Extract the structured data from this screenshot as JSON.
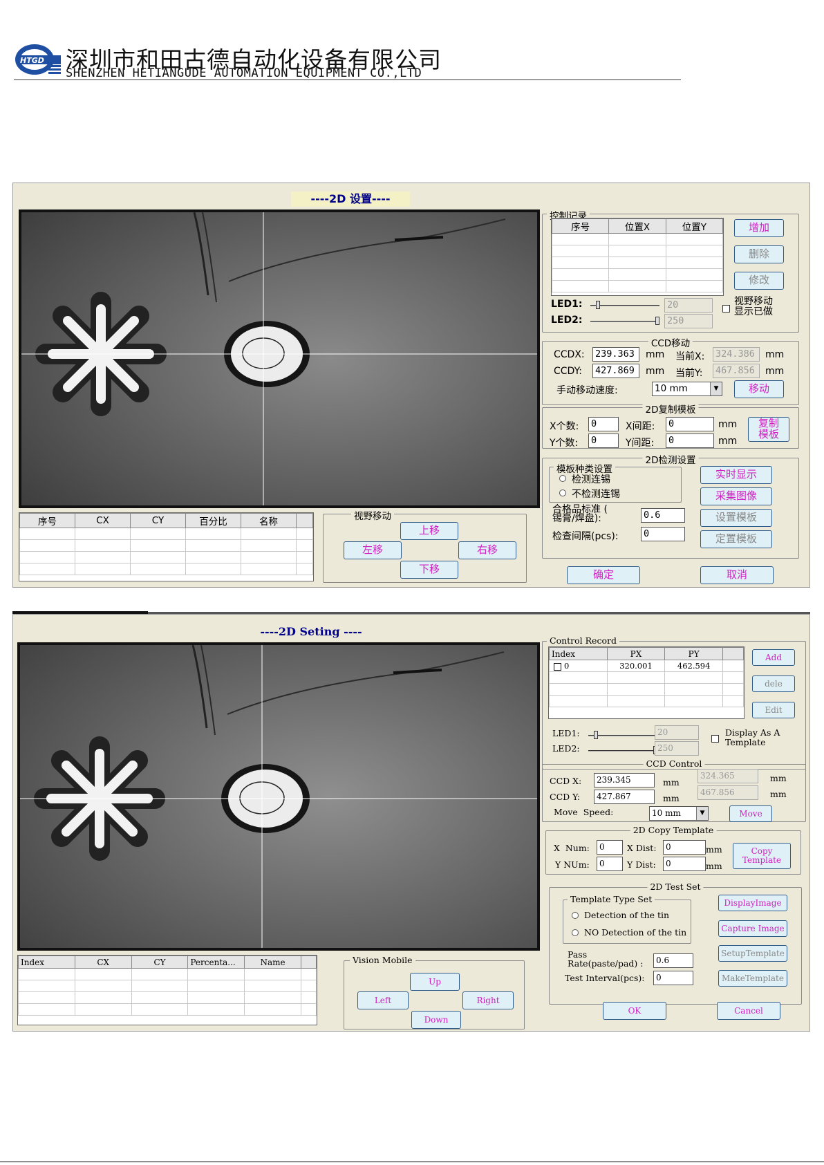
{
  "header": {
    "logo_text": "HTGD",
    "company_cn": "深圳市和田古德自动化设备有限公司",
    "company_en": "SHENZHEN HETIANGUDE AUTOMATION EQUIPMENT CO.,LTD"
  },
  "cn": {
    "title": "----2D 设置----",
    "record_group": "控制记录",
    "record_cols": [
      "序号",
      "位置X",
      "位置Y"
    ],
    "add": "增加",
    "delete": "删除",
    "edit": "修改",
    "led1": "LED1:",
    "led1_value": "20",
    "led1_level": 0.08,
    "led2": "LED2:",
    "led2_value": "250",
    "led2_level": 1.0,
    "display_check": "视野移动\n显示已做",
    "ccd_group": "CCD移动",
    "ccdx_label": "CCDX:",
    "ccdx_value": "239.363",
    "ccdy_label": "CCDY:",
    "ccdy_value": "427.869",
    "mm": "mm",
    "curx_label": "当前X:",
    "curx_value": "324.386",
    "cury_label": "当前Y:",
    "cury_value": "467.856",
    "speed_label": "手动移动速度:",
    "speed_value": "10 mm",
    "move": "移动",
    "copy_group": "2D复制模板",
    "xnum_label": "X个数:",
    "xnum_value": "0",
    "ynum_label": "Y个数:",
    "ynum_value": "0",
    "xdist_label": "X间距:",
    "xdist_value": "0",
    "ydist_label": "Y间距:",
    "ydist_value": "0",
    "copy_btn": "复制\n模板",
    "test_group": "2D检测设置",
    "type_group": "模板种类设置",
    "radio1": "检测连锡",
    "radio2": "不检测连锡",
    "pass_label": "合格品标准 (\n锡膏/焊盘):",
    "pass_value": "0.6",
    "interval_label": "检查间隔(pcs):",
    "interval_value": "0",
    "display_btn": "实时显示",
    "capture_btn": "采集图像",
    "setup_btn": "设置模板",
    "make_btn": "定置模板",
    "ok": "确定",
    "cancel": "取消",
    "result_cols": [
      "序号",
      "CX",
      "CY",
      "百分比",
      "名称"
    ],
    "vision_group": "视野移动",
    "up": "上移",
    "down": "下移",
    "left": "左移",
    "right": "右移"
  },
  "en": {
    "title": "----2D Seting ----",
    "record_group": "Control Record",
    "record_cols": [
      "Index",
      "PX",
      "PY"
    ],
    "record_rows": [
      [
        "0",
        "320.001",
        "462.594"
      ]
    ],
    "add": "Add",
    "delete": "dele",
    "edit": "Edit",
    "led1": "LED1:",
    "led1_value": "20",
    "led1_level": 0.08,
    "led2": "LED2:",
    "led2_value": "250",
    "led2_level": 1.0,
    "display_check": "Display As A\nTemplate",
    "ccd_group": "CCD Control",
    "ccdx_label": "CCD X:",
    "ccdx_value": "239.345",
    "ccdy_label": "CCD Y:",
    "ccdy_value": "427.867",
    "mm": "mm",
    "curx_value": "324.365",
    "cury_value": "467.856",
    "speed_label": "Move  Speed:",
    "speed_value": "10 mm",
    "move": "Move",
    "copy_group": "2D Copy Template",
    "xnum_label": "X  Num:",
    "xnum_value": "0",
    "ynum_label": "Y NUm:",
    "ynum_value": "0",
    "xdist_label": "X Dist:",
    "xdist_value": "0",
    "ydist_label": "Y Dist:",
    "ydist_value": "0",
    "copy_btn": "Copy\nTemplate",
    "test_group": "2D Test Set",
    "type_group": "Template Type Set",
    "radio1": "Detection of the tin",
    "radio2": "NO Detection of the tin",
    "pass_label": "Pass\nRate(paste/pad) :",
    "pass_value": "0.6",
    "interval_label": "Test Interval(pcs):",
    "interval_value": "0",
    "display_btn": "DisplayImage",
    "capture_btn": "Capture Image",
    "setup_btn": "SetupTemplate",
    "make_btn": "MakeTemplate",
    "ok": "OK",
    "cancel": "Cancel",
    "result_cols": [
      "Index",
      "CX",
      "CY",
      "Percenta...",
      "Name"
    ],
    "vision_group": "Vision Mobile",
    "up": "Up",
    "down": "Down",
    "left": "Left",
    "right": "Right"
  }
}
